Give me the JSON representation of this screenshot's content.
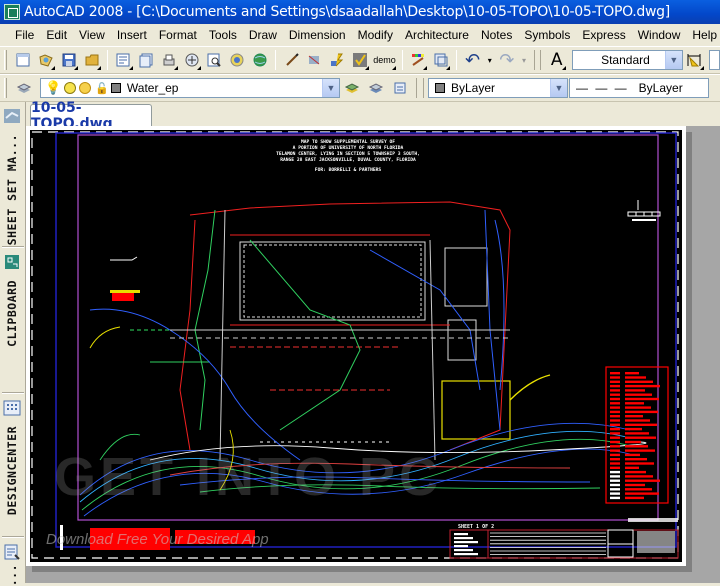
{
  "window": {
    "title": "AutoCAD 2008 - [C:\\Documents and Settings\\dsaadallah\\Desktop\\10-05-TOPO\\10-05-TOPO.dwg]"
  },
  "menu": {
    "items": [
      "File",
      "Edit",
      "View",
      "Insert",
      "Format",
      "Tools",
      "Draw",
      "Dimension",
      "Modify",
      "Architecture",
      "Notes",
      "Symbols",
      "Express",
      "Window",
      "Help"
    ]
  },
  "toolbar_standard": {
    "buttons": [
      {
        "name": "qnew-icon"
      },
      {
        "name": "open-icon"
      },
      {
        "name": "save-icon"
      },
      {
        "name": "folder-icon"
      },
      {
        "name": "plot-icon"
      },
      {
        "name": "page-setup-icon"
      },
      {
        "name": "publish-icon"
      },
      {
        "name": "etransmit-icon"
      },
      {
        "name": "plot-preview-icon"
      },
      {
        "name": "3d-dwf-icon"
      },
      {
        "name": "web-icon"
      },
      {
        "name": "brush-icon"
      },
      {
        "name": "match-properties-icon"
      },
      {
        "name": "block-editor-icon"
      },
      {
        "name": "cleanup-icon"
      }
    ],
    "demo_label": "demo",
    "undo": "undo-icon",
    "redo": "redo-icon",
    "text_style_value": "Standard",
    "dim_style_icon": "dimension-style-icon"
  },
  "toolbar_layers": {
    "layer_value": "Water_ep",
    "color_value": "ByLayer",
    "linetype_value": "ByLayer"
  },
  "document_tab": {
    "label": "10-05-TOPO.dwg"
  },
  "tool_palettes": {
    "tabs": [
      {
        "label": "SHEET SET MA..."
      },
      {
        "label": "CLIPBOARD"
      },
      {
        "label": "DESIGNCENTER"
      },
      {
        "label": "..."
      }
    ]
  },
  "drawing": {
    "title_lines": [
      "MAP TO SHOW SUPPLEMENTAL SURVEY OF",
      "A PORTION OF UNIVERSITY OF NORTH FLORIDA",
      "TELAMON CENTER, LYING IN SECTION 5 TOWNSHIP 3 SOUTH,",
      "RANGE 28 EAST JACKSONVILLE, DUVAL COUNTY, FLORIDA"
    ],
    "for_line": "FOR: BORRELLI & PARTNERS",
    "sheet_label": "SHEET 1 OF 2"
  },
  "watermark": {
    "brand": "GET INTO PC",
    "tagline": "Download Free Your Desired App"
  },
  "colors": {
    "titlebar": "#0a5fe0",
    "chrome": "#ece9d8",
    "canvas": "#000000",
    "border_magenta": "#b050d0",
    "border_blue": "#2020c0",
    "legend_red": "#ff0000"
  }
}
